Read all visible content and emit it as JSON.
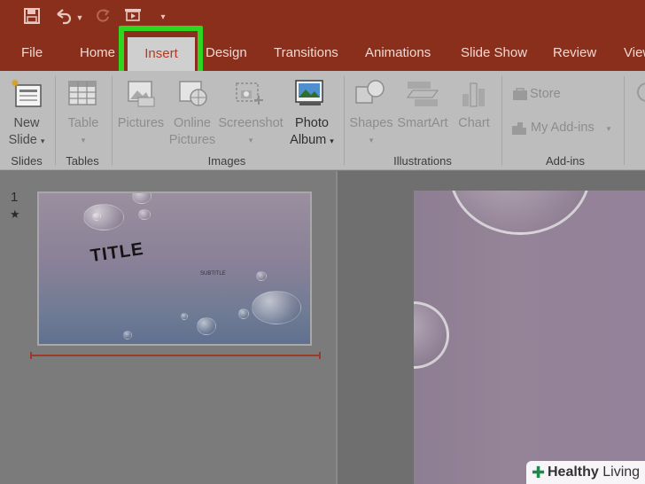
{
  "qat": {
    "save_icon": "save-icon",
    "undo_icon": "undo-icon",
    "redo_icon": "redo-icon",
    "present_icon": "start-from-beginning-icon",
    "customize_icon": "customize-qat-icon"
  },
  "tabs": [
    {
      "label": "File"
    },
    {
      "label": "Home"
    },
    {
      "label": "Insert"
    },
    {
      "label": "Design"
    },
    {
      "label": "Transitions"
    },
    {
      "label": "Animations"
    },
    {
      "label": "Slide Show"
    },
    {
      "label": "Review"
    },
    {
      "label": "View"
    }
  ],
  "active_tab": "Insert",
  "ribbon": {
    "new_slide": {
      "line1": "New",
      "line2": "Slide"
    },
    "table": {
      "label": "Table"
    },
    "pictures": {
      "label": "Pictures"
    },
    "online_pictures": {
      "line1": "Online",
      "line2": "Pictures"
    },
    "screenshot": {
      "label": "Screenshot"
    },
    "photo_album": {
      "line1": "Photo",
      "line2": "Album"
    },
    "shapes": {
      "label": "Shapes"
    },
    "smartart": {
      "label": "SmartArt"
    },
    "chart": {
      "label": "Chart"
    },
    "store": {
      "label": "Store"
    },
    "my_addins": {
      "label": "My Add-ins"
    },
    "groups": {
      "slides": "Slides",
      "tables": "Tables",
      "images": "Images",
      "illustrations": "Illustrations",
      "addins": "Add-ins"
    }
  },
  "thumbnails": {
    "slide_number": "1",
    "star": "★",
    "title": "TITLE",
    "subtitle": "SUBTITLE"
  },
  "watermark": {
    "brand_bold": "Healthy",
    "brand_rest": " Living"
  },
  "colors": {
    "title_bar": "#8a2f1b",
    "active_tab_text": "#b33b22",
    "highlight": "#2fd61f",
    "ribbon_bg": "#bdbdbd"
  }
}
